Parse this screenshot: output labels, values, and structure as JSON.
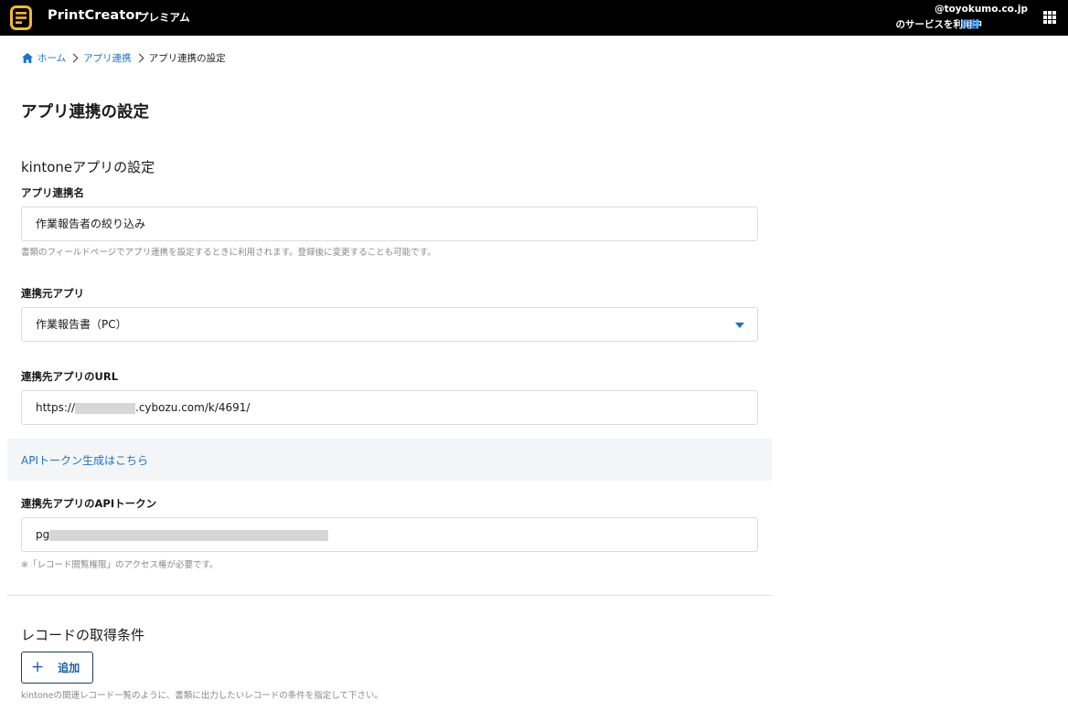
{
  "header": {
    "brand": "PrintCreator",
    "plan": "プレミアム",
    "user_email": "@toyokumo.co.jp",
    "user_status": "のサービスを利用中",
    "switch_label": "切替"
  },
  "breadcrumb": {
    "home": "ホーム",
    "app_link": "アプリ連携",
    "current": "アプリ連携の設定"
  },
  "page_title": "アプリ連携の設定",
  "kintone_section": {
    "title": "kintoneアプリの設定",
    "link_name": {
      "label": "アプリ連携名",
      "value": "作業報告者の絞り込み",
      "hint": "書類のフィールドページでアプリ連携を設定するときに利用されます。登録後に変更することも可能です。"
    },
    "source_app": {
      "label": "連携元アプリ",
      "value": "作業報告書（PC）"
    },
    "target_url": {
      "label": "連携先アプリのURL",
      "value_prefix": "https://",
      "value_suffix": ".cybozu.com/k/4691/"
    },
    "token_link": "APIトークン生成はこちら",
    "api_token": {
      "label": "連携先アプリのAPIトークン",
      "value_prefix": "pg",
      "hint": "※「レコード閲覧権限」のアクセス権が必要です。"
    }
  },
  "record_section": {
    "title": "レコードの取得条件",
    "add_label": "追加",
    "hint": "kintoneの関連レコード一覧のように、書類に出力したいレコードの条件を指定して下さい。"
  },
  "colors": {
    "header_bg": "#000000",
    "logo_accent": "#f5b82e",
    "link": "#1a73c8",
    "header_link": "#3b9dff"
  }
}
